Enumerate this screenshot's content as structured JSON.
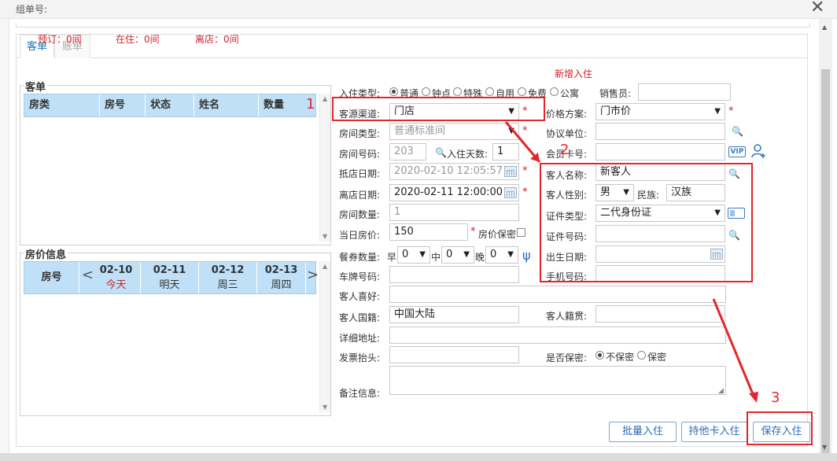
{
  "window": {
    "title": "组单号:",
    "close_icon": "close-icon",
    "close_glyph": "✕"
  },
  "tabs": [
    {
      "label": "客单"
    },
    {
      "label": "账单"
    }
  ],
  "stats": {
    "reserved": "预订：0间",
    "in_house": "在住：0间",
    "departed": "离店：0间"
  },
  "new_stay": "新增入住",
  "guest_list": {
    "legend": "客单",
    "columns": [
      "房类",
      "房号",
      "状态",
      "姓名",
      "数量"
    ]
  },
  "price_info": {
    "legend": "房价信息",
    "room_label": "房号",
    "days": [
      {
        "date": "02-10",
        "day": "今天"
      },
      {
        "date": "02-11",
        "day": "明天"
      },
      {
        "date": "02-12",
        "day": "周三"
      },
      {
        "date": "02-13",
        "day": "周四"
      }
    ],
    "prev_glyph": "<",
    "next_glyph": ">"
  },
  "form": {
    "stay_type_label": "入住类型:",
    "stay_types": [
      "普通",
      "钟点",
      "特殊",
      "自用",
      "免费",
      "公寓"
    ],
    "salesperson_label": "销售员:",
    "salesperson_value": "",
    "source_label": "客源渠道:",
    "source_value": "门店",
    "price_plan_label": "价格方案:",
    "price_plan_value": "门市价",
    "room_type_label": "房间类型:",
    "room_type_value": "普通标准间",
    "agreement_label": "协议单位:",
    "agreement_value": "",
    "room_no_label": "房间号码:",
    "room_no_value": "203",
    "nights_label": "入住天数:",
    "nights_value": "1",
    "member_label": "会员卡号:",
    "member_value": "",
    "arrival_label": "抵店日期:",
    "arrival_value": "2020-02-10 12:05:57",
    "departure_label": "离店日期:",
    "departure_value": "2020-02-11 12:00:00",
    "room_count_label": "房间数量:",
    "room_count_value": "1",
    "day_price_label": "当日房价:",
    "day_price_value": "150",
    "price_secret_label": "房价保密",
    "meal_label": "餐券数量:",
    "meal_breakfast": "早",
    "meal_lunch": "中",
    "meal_dinner": "晚",
    "meal_b_value": "0",
    "meal_l_value": "0",
    "meal_d_value": "0",
    "plate_label": "车牌号码:",
    "plate_value": "",
    "hobby_label": "客人喜好:",
    "hobby_value": "",
    "nationality_label": "客人国籍:",
    "nationality_value": "中国大陆",
    "origin_label": "客人籍贯:",
    "origin_value": "",
    "address_label": "详细地址:",
    "address_value": "",
    "invoice_label": "发票抬头:",
    "invoice_value": "",
    "confidential_label": "是否保密:",
    "confidential_options": [
      "不保密",
      "保密"
    ],
    "remarks_label": "备注信息:",
    "remarks_value": ""
  },
  "guest": {
    "name_label": "客人名称:",
    "name_value": "新客人",
    "gender_label": "客人性别:",
    "gender_value": "男",
    "ethnicity_label": "民族:",
    "ethnicity_value": "汉族",
    "id_type_label": "证件类型:",
    "id_type_value": "二代身份证",
    "id_no_label": "证件号码:",
    "id_no_value": "",
    "birth_label": "出生日期:",
    "birth_value": "",
    "phone_label": "手机号码:",
    "phone_value": ""
  },
  "vip_badge": "VIP",
  "annotations": [
    "1",
    "2",
    "3"
  ],
  "buttons": {
    "batch": "批量入住",
    "other_card": "持他卡入住",
    "save": "保存入住"
  },
  "colors": {
    "accent": "#2b6cb5",
    "header_bg": "#bfe0f7",
    "alert_red": "#d2232a",
    "annotation_red": "#e3262b"
  }
}
